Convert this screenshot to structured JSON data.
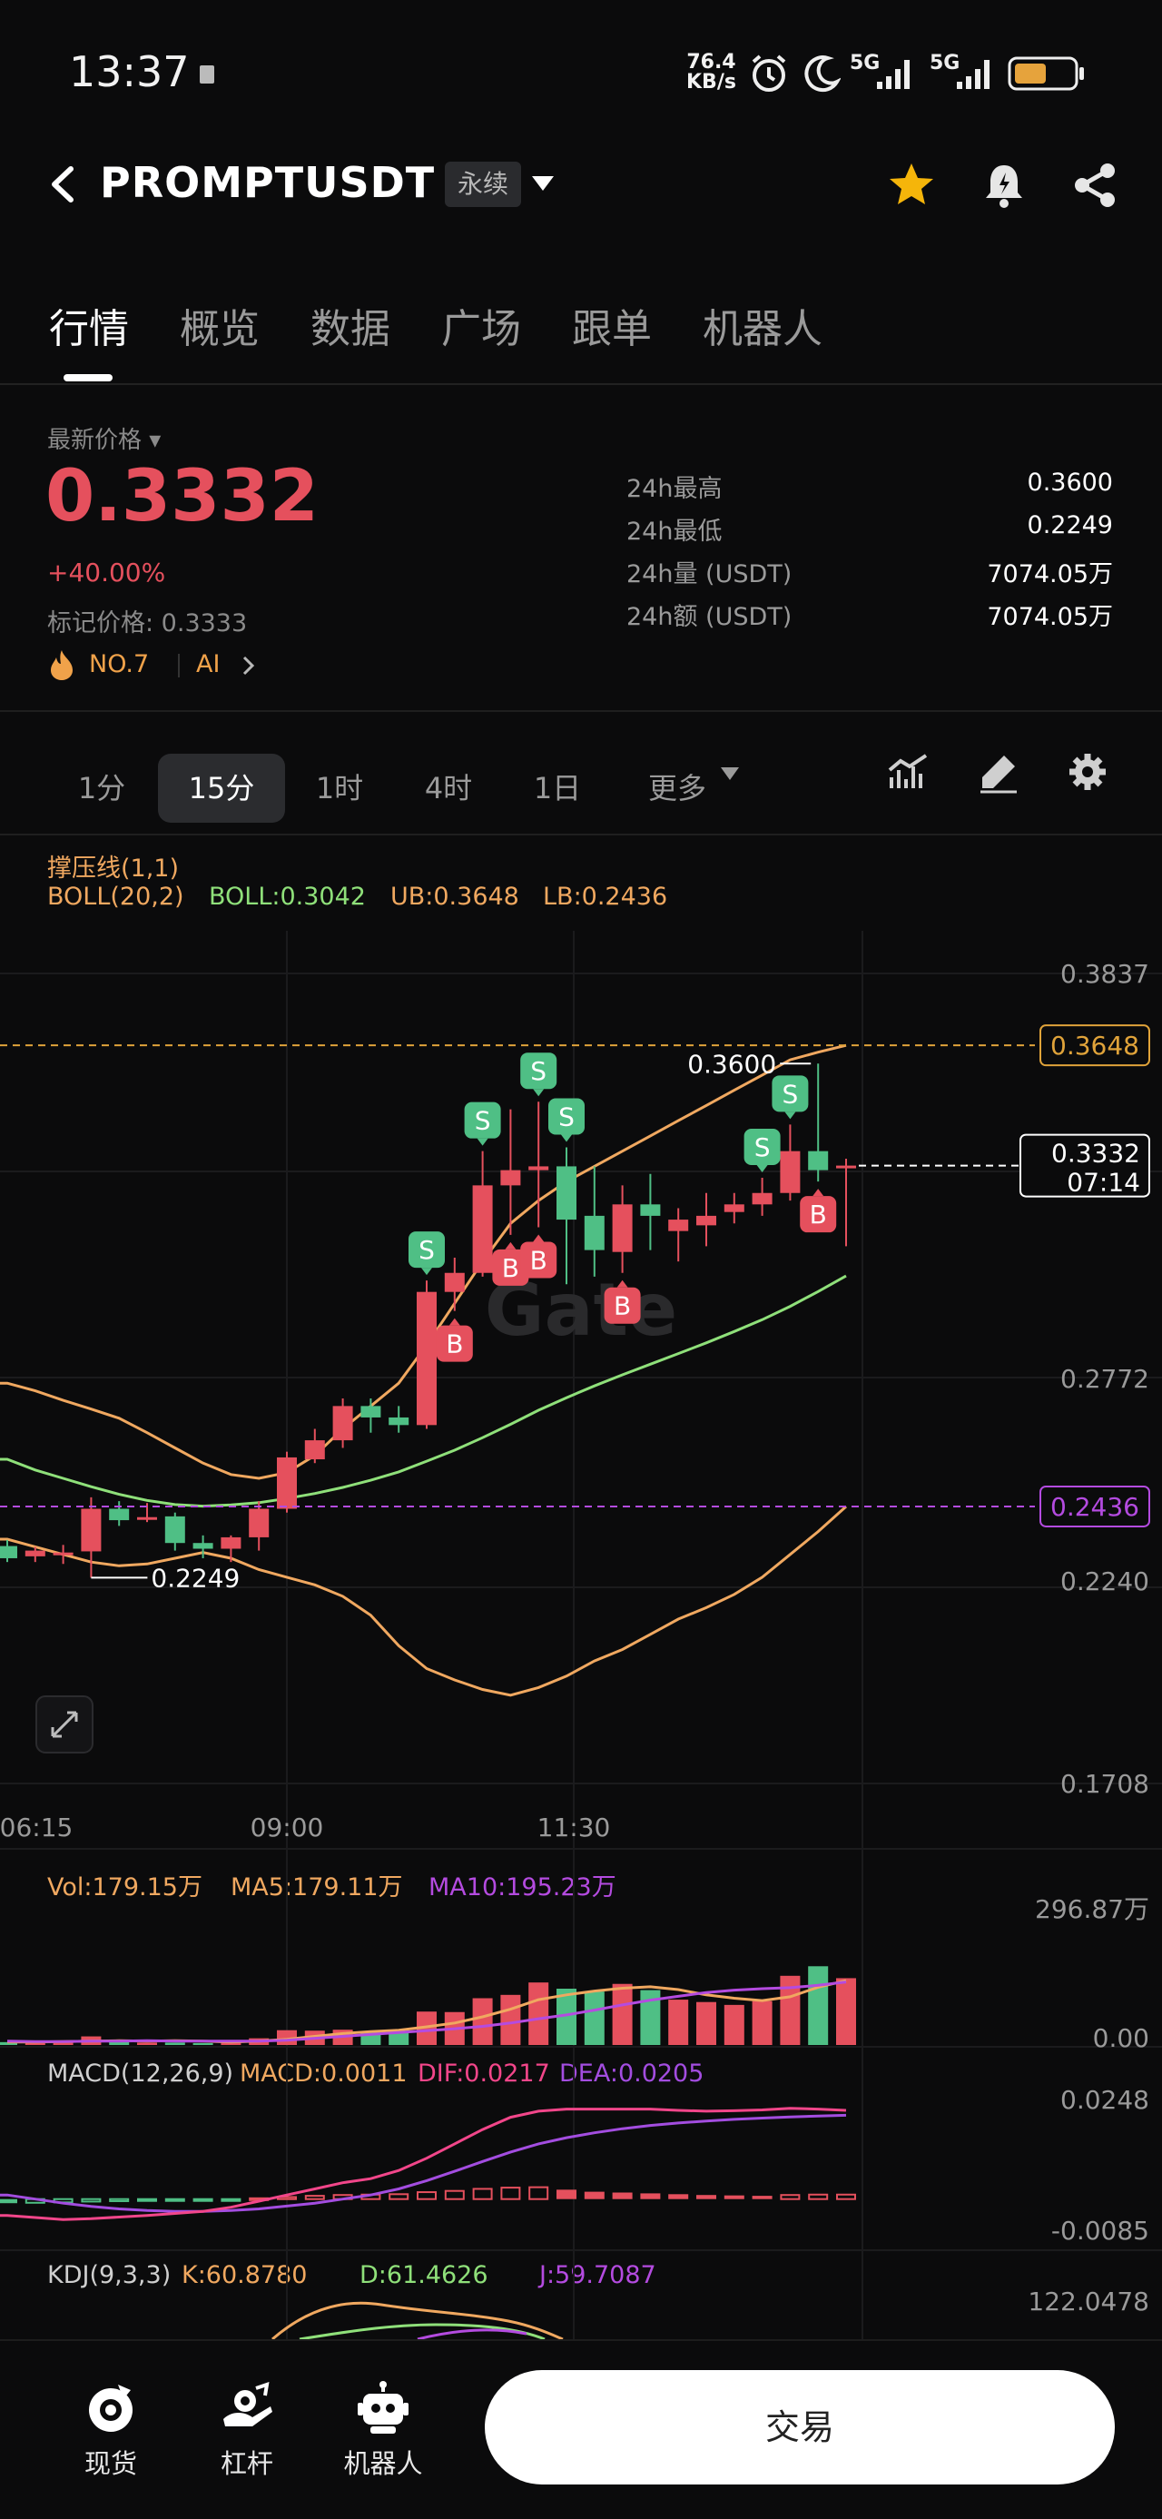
{
  "status_bar": {
    "time": "13:37",
    "net_speed_value": "76.4",
    "net_speed_unit": "KB/s",
    "signal_1": "5G",
    "signal_2": "5G"
  },
  "header": {
    "pair": "PROMPTUSDT",
    "contract_type": "永续"
  },
  "tabs": [
    {
      "label": "行情",
      "active": true
    },
    {
      "label": "概览",
      "active": false
    },
    {
      "label": "数据",
      "active": false
    },
    {
      "label": "广场",
      "active": false
    },
    {
      "label": "跟单",
      "active": false
    },
    {
      "label": "机器人",
      "active": false
    }
  ],
  "price": {
    "label": "最新价格",
    "last": "0.3332",
    "change": "+40.00%",
    "mark": "标记价格: 0.3333",
    "rank": "NO.7",
    "ai": "AI"
  },
  "stats": [
    {
      "label": "24h最高",
      "value": "0.3600"
    },
    {
      "label": "24h最低",
      "value": "0.2249"
    },
    {
      "label": "24h量 (USDT)",
      "value": "7074.05万"
    },
    {
      "label": "24h额 (USDT)",
      "value": "7074.05万"
    }
  ],
  "timeframes": [
    {
      "label": "1分",
      "active": false
    },
    {
      "label": "15分",
      "active": true
    },
    {
      "label": "1时",
      "active": false
    },
    {
      "label": "4时",
      "active": false
    },
    {
      "label": "1日",
      "active": false
    },
    {
      "label": "更多",
      "active": false
    }
  ],
  "indicators": {
    "support": "撑压线(1,1)",
    "boll_name": "BOLL(20,2)",
    "boll_mid": "BOLL:0.3042",
    "boll_ub": "UB:0.3648",
    "boll_lb": "LB:0.2436",
    "vol": "Vol:179.15万",
    "ma5": "MA5:179.11万",
    "ma10": "MA10:195.23万",
    "macd_name": "MACD(12,26,9)",
    "macd_val": "MACD:0.0011",
    "dif": "DIF:0.0217",
    "dea": "DEA:0.0205",
    "kdj_name": "KDJ(9,3,3)",
    "kdj_k": "K:60.8780",
    "kdj_d": "D:61.4626",
    "kdj_j": "J:59.7087"
  },
  "colors": {
    "up": "#e5505d",
    "down": "#4fbf85",
    "boll_mid": "#8fe07a",
    "boll_band": "#f0a860",
    "ma10": "#b44be0",
    "dif": "#f2468a",
    "dea": "#a34de0"
  },
  "chart_data": [
    {
      "type": "candlestick",
      "title": "",
      "x_ticks": [
        "06:15",
        "09:00",
        "11:30"
      ],
      "y_ticks": [
        0.3837,
        0.2772,
        0.224,
        0.1708
      ],
      "y_tick_labels": [
        "0.3837",
        "0.2772",
        "0.2240",
        "0.1708"
      ],
      "ylim": [
        0.1708,
        0.3837
      ],
      "price_tags": {
        "ub": "0.3648",
        "lb": "0.2436",
        "current": "0.3332",
        "countdown": "07:14"
      },
      "high_label": "0.3600",
      "low_label": "0.2249",
      "candles": [
        {
          "o": 0.2332,
          "h": 0.2348,
          "l": 0.229,
          "c": 0.23
        },
        {
          "o": 0.2305,
          "h": 0.233,
          "l": 0.229,
          "c": 0.232
        },
        {
          "o": 0.231,
          "h": 0.2335,
          "l": 0.2285,
          "c": 0.2315
        },
        {
          "o": 0.2318,
          "h": 0.246,
          "l": 0.2249,
          "c": 0.243
        },
        {
          "o": 0.243,
          "h": 0.245,
          "l": 0.2385,
          "c": 0.24
        },
        {
          "o": 0.2402,
          "h": 0.2445,
          "l": 0.2395,
          "c": 0.2408
        },
        {
          "o": 0.241,
          "h": 0.242,
          "l": 0.232,
          "c": 0.234
        },
        {
          "o": 0.234,
          "h": 0.236,
          "l": 0.23,
          "c": 0.2325
        },
        {
          "o": 0.2325,
          "h": 0.236,
          "l": 0.229,
          "c": 0.2355
        },
        {
          "o": 0.2355,
          "h": 0.245,
          "l": 0.232,
          "c": 0.243
        },
        {
          "o": 0.243,
          "h": 0.258,
          "l": 0.242,
          "c": 0.2565
        },
        {
          "o": 0.256,
          "h": 0.264,
          "l": 0.255,
          "c": 0.261
        },
        {
          "o": 0.261,
          "h": 0.272,
          "l": 0.259,
          "c": 0.27
        },
        {
          "o": 0.27,
          "h": 0.272,
          "l": 0.263,
          "c": 0.267
        },
        {
          "o": 0.267,
          "h": 0.27,
          "l": 0.263,
          "c": 0.265
        },
        {
          "o": 0.265,
          "h": 0.303,
          "l": 0.264,
          "c": 0.3
        },
        {
          "o": 0.3,
          "h": 0.309,
          "l": 0.295,
          "c": 0.305
        },
        {
          "o": 0.305,
          "h": 0.337,
          "l": 0.304,
          "c": 0.328
        },
        {
          "o": 0.328,
          "h": 0.348,
          "l": 0.315,
          "c": 0.332
        },
        {
          "o": 0.332,
          "h": 0.35,
          "l": 0.317,
          "c": 0.333
        },
        {
          "o": 0.333,
          "h": 0.338,
          "l": 0.302,
          "c": 0.319
        },
        {
          "o": 0.32,
          "h": 0.333,
          "l": 0.304,
          "c": 0.311
        },
        {
          "o": 0.3105,
          "h": 0.328,
          "l": 0.305,
          "c": 0.323
        },
        {
          "o": 0.323,
          "h": 0.331,
          "l": 0.311,
          "c": 0.32
        },
        {
          "o": 0.316,
          "h": 0.322,
          "l": 0.308,
          "c": 0.319
        },
        {
          "o": 0.3175,
          "h": 0.326,
          "l": 0.312,
          "c": 0.32
        },
        {
          "o": 0.321,
          "h": 0.326,
          "l": 0.318,
          "c": 0.323
        },
        {
          "o": 0.323,
          "h": 0.33,
          "l": 0.32,
          "c": 0.326
        },
        {
          "o": 0.326,
          "h": 0.344,
          "l": 0.324,
          "c": 0.337
        },
        {
          "o": 0.337,
          "h": 0.36,
          "l": 0.329,
          "c": 0.332
        },
        {
          "o": 0.3332,
          "h": 0.335,
          "l": 0.312,
          "c": 0.3332
        }
      ],
      "markers": [
        {
          "index": 15,
          "side": "S"
        },
        {
          "index": 16,
          "side": "B"
        },
        {
          "index": 17,
          "side": "S"
        },
        {
          "index": 18,
          "side": "B"
        },
        {
          "index": 19,
          "side": "S"
        },
        {
          "index": 19,
          "side": "B"
        },
        {
          "index": 20,
          "side": "S"
        },
        {
          "index": 22,
          "side": "B"
        },
        {
          "index": 27,
          "side": "S"
        },
        {
          "index": 28,
          "side": "S"
        },
        {
          "index": 29,
          "side": "B"
        }
      ],
      "boll_mid": [
        0.256,
        0.2532,
        0.251,
        0.2488,
        0.2468,
        0.2452,
        0.2441,
        0.2437,
        0.244,
        0.2446,
        0.2457,
        0.247,
        0.2486,
        0.2505,
        0.2527,
        0.2555,
        0.2584,
        0.2617,
        0.2652,
        0.2689,
        0.2722,
        0.2753,
        0.2782,
        0.281,
        0.2838,
        0.2866,
        0.2896,
        0.2927,
        0.2962,
        0.3001,
        0.3042
      ],
      "boll_ub": [
        0.276,
        0.274,
        0.2715,
        0.2692,
        0.2668,
        0.263,
        0.259,
        0.255,
        0.252,
        0.251,
        0.2525,
        0.257,
        0.264,
        0.27,
        0.276,
        0.286,
        0.297,
        0.308,
        0.318,
        0.324,
        0.329,
        0.333,
        0.337,
        0.341,
        0.345,
        0.349,
        0.353,
        0.357,
        0.361,
        0.363,
        0.3648
      ],
      "boll_lb": [
        0.235,
        0.233,
        0.231,
        0.229,
        0.228,
        0.2285,
        0.23,
        0.2315,
        0.23,
        0.227,
        0.225,
        0.223,
        0.22,
        0.215,
        0.207,
        0.201,
        0.198,
        0.1955,
        0.194,
        0.196,
        0.199,
        0.203,
        0.206,
        0.21,
        0.214,
        0.217,
        0.2205,
        0.225,
        0.231,
        0.237,
        0.2436
      ]
    },
    {
      "type": "bar",
      "name": "volume",
      "ylim": [
        0,
        296.87
      ],
      "y_tick_labels": [
        "296.87万",
        "0.00"
      ],
      "values": [
        6,
        4,
        5,
        18,
        6,
        5,
        5,
        4,
        6,
        14,
        31,
        30,
        32,
        28,
        30,
        70,
        69,
        98,
        105,
        131,
        118,
        112,
        128,
        115,
        95,
        90,
        84,
        92,
        145,
        165,
        140
      ],
      "ma5": [
        6,
        6,
        7,
        8,
        9,
        8,
        9,
        8,
        6,
        8,
        12,
        18,
        24,
        28,
        31,
        38,
        46,
        59,
        75,
        95,
        105,
        113,
        119,
        122,
        116,
        105,
        98,
        93,
        101,
        121,
        135
      ],
      "ma10": [
        8,
        7,
        7,
        8,
        8,
        9,
        8,
        8,
        8,
        8,
        10,
        14,
        18,
        22,
        26,
        30,
        34,
        39,
        46,
        55,
        63,
        73,
        84,
        94,
        102,
        110,
        115,
        118,
        120,
        125,
        132
      ]
    },
    {
      "type": "bar",
      "name": "macd",
      "ylim": [
        -0.0085,
        0.0248
      ],
      "y_tick_labels": [
        "0.0248",
        "-0.0085"
      ],
      "hist": [
        -0.001,
        -0.0009,
        -0.0008,
        -0.0006,
        -0.0005,
        -0.0004,
        -0.0003,
        -0.0002,
        -0.0001,
        0.0002,
        0.0005,
        0.0008,
        0.001,
        0.0011,
        0.0012,
        0.0017,
        0.002,
        0.0025,
        0.0028,
        0.0029,
        0.0023,
        0.0018,
        0.0016,
        0.0014,
        0.0012,
        0.001,
        0.0009,
        0.0008,
        0.001,
        0.0011,
        0.0011
      ],
      "dif": [
        -0.004,
        -0.0045,
        -0.005,
        -0.0048,
        -0.0044,
        -0.004,
        -0.0035,
        -0.003,
        -0.002,
        -0.0005,
        0.001,
        0.0025,
        0.004,
        0.005,
        0.007,
        0.01,
        0.0135,
        0.017,
        0.02,
        0.0215,
        0.022,
        0.022,
        0.022,
        0.022,
        0.0217,
        0.0215,
        0.0216,
        0.0218,
        0.0222,
        0.022,
        0.0217
      ],
      "dea": [
        0.001,
        0.0,
        -0.001,
        -0.0018,
        -0.0024,
        -0.0028,
        -0.003,
        -0.003,
        -0.0028,
        -0.0024,
        -0.0017,
        -0.001,
        0.0,
        0.001,
        0.0025,
        0.0045,
        0.0068,
        0.0092,
        0.0115,
        0.0135,
        0.015,
        0.0162,
        0.0172,
        0.018,
        0.0186,
        0.0191,
        0.0195,
        0.0198,
        0.0201,
        0.0203,
        0.0205
      ]
    },
    {
      "type": "line",
      "name": "kdj",
      "y_tick_labels": [
        "122.0478"
      ]
    }
  ]
}
